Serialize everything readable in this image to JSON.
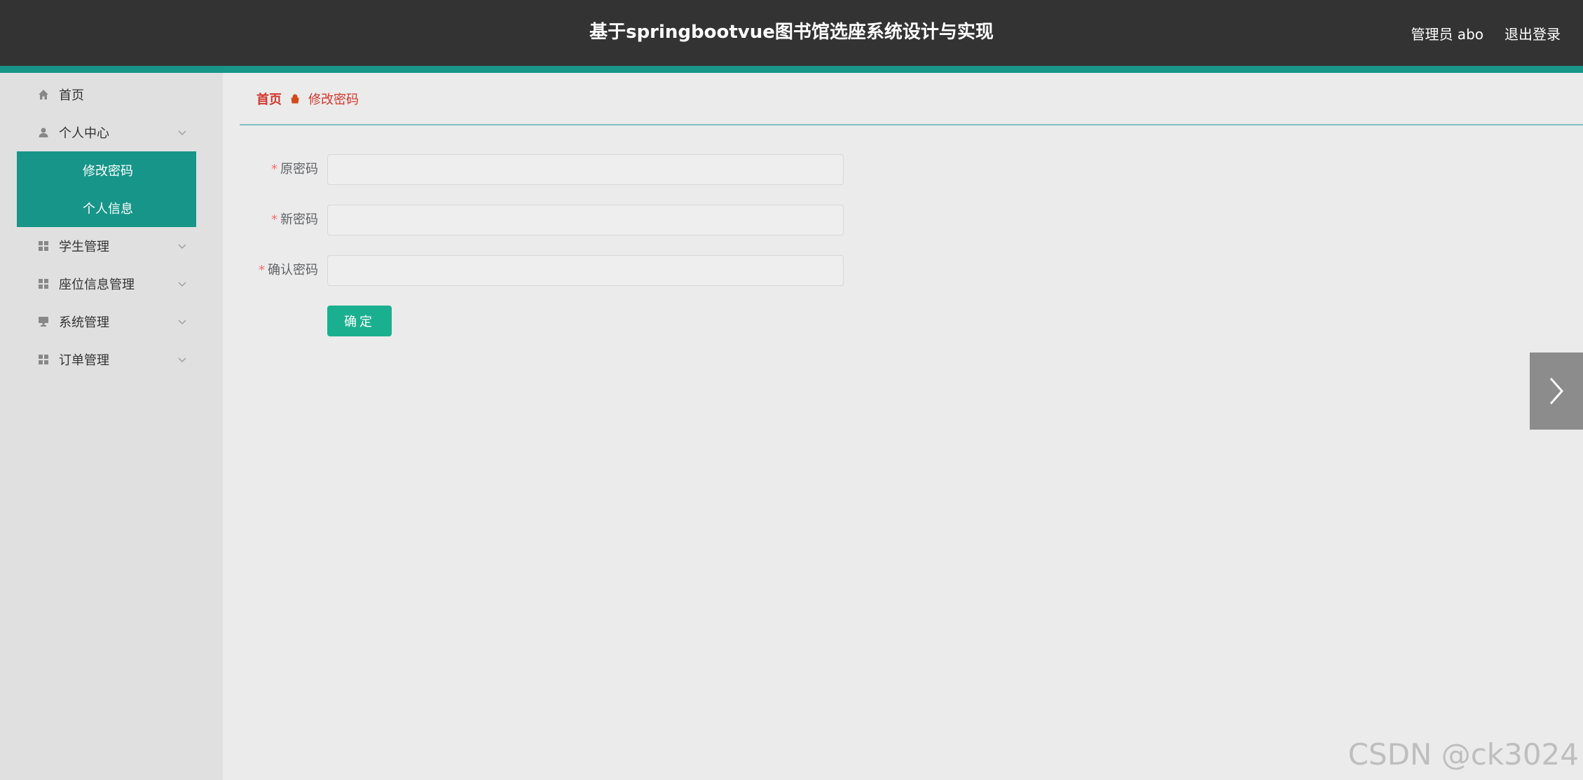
{
  "header": {
    "title": "基于springbootvue图书馆选座系统设计与实现",
    "user_label": "管理员 abo",
    "logout_label": "退出登录"
  },
  "sidebar": {
    "items": [
      {
        "label": "首页",
        "icon": "home-icon"
      },
      {
        "label": "个人中心",
        "icon": "user-icon",
        "expanded": true,
        "children": [
          {
            "label": "修改密码"
          },
          {
            "label": "个人信息"
          }
        ]
      },
      {
        "label": "学生管理",
        "icon": "grid-icon"
      },
      {
        "label": "座位信息管理",
        "icon": "grid-icon"
      },
      {
        "label": "系统管理",
        "icon": "monitor-icon"
      },
      {
        "label": "订单管理",
        "icon": "grid-icon"
      }
    ]
  },
  "breadcrumb": {
    "home": "首页",
    "current": "修改密码"
  },
  "form": {
    "old_password_label": "原密码",
    "new_password_label": "新密码",
    "confirm_password_label": "确认密码",
    "required_mark": "*",
    "old_password_value": "",
    "new_password_value": "",
    "confirm_password_value": "",
    "submit_label": "确定"
  },
  "watermark": "CSDN @ck3024",
  "colors": {
    "header_bg": "#333333",
    "accent": "#179589",
    "button": "#1ab08f",
    "breadcrumb_text": "#d3352a"
  }
}
